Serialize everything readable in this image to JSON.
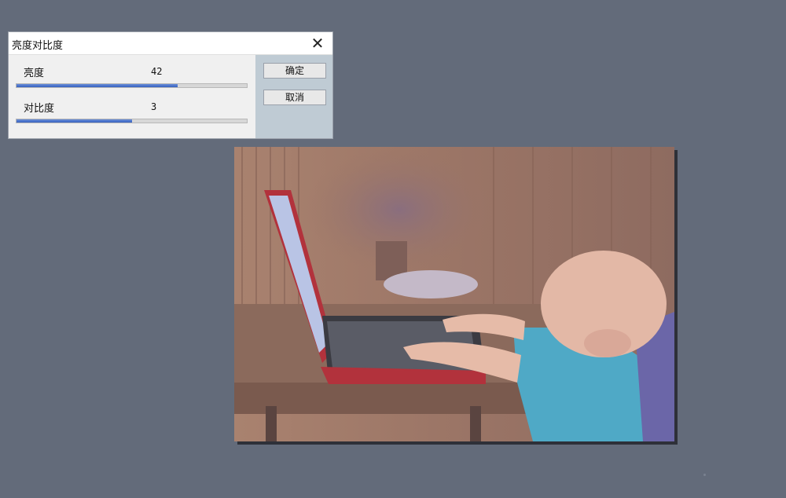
{
  "dialog": {
    "title": "亮度对比度",
    "close_icon": "close-icon",
    "brightness": {
      "label": "亮度",
      "value": "42",
      "level": 0.7
    },
    "contrast": {
      "label": "对比度",
      "value": "3",
      "level": 0.5
    },
    "ok_label": "确定",
    "cancel_label": "取消"
  },
  "colors": {
    "background": "#636b7a",
    "slider_fill": "#3560c0",
    "side_panel": "#bfcbd4"
  }
}
